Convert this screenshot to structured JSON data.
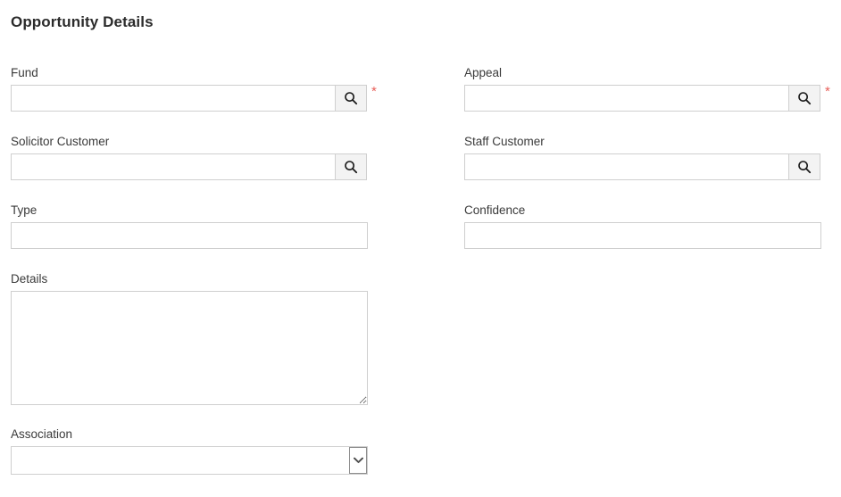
{
  "page": {
    "title": "Opportunity Details"
  },
  "colors": {
    "required_star": "#e8605a",
    "label_text": "#3a3a3a",
    "heading_text": "#2b2b2b",
    "input_border": "#cfcfcf",
    "button_face": "#f3f3f3",
    "page_background": "#ffffff"
  },
  "required_marker": "*",
  "icons": {
    "search": "search-icon",
    "chevron_down": "chevron-down-icon",
    "resize_grip": "resize-grip-icon"
  },
  "fields": {
    "fund": {
      "label": "Fund",
      "value": "",
      "placeholder": "",
      "type": "lookup",
      "required": true,
      "button_title": "Search"
    },
    "appeal": {
      "label": "Appeal",
      "value": "",
      "placeholder": "",
      "type": "lookup",
      "required": true,
      "button_title": "Search"
    },
    "solicitor_customer": {
      "label": "Solicitor Customer",
      "value": "",
      "placeholder": "",
      "type": "lookup",
      "required": false,
      "button_title": "Search"
    },
    "staff_customer": {
      "label": "Staff Customer",
      "value": "",
      "placeholder": "",
      "type": "lookup",
      "required": false,
      "button_title": "Search"
    },
    "type": {
      "label": "Type",
      "value": "",
      "placeholder": "",
      "type": "text",
      "required": false
    },
    "confidence": {
      "label": "Confidence",
      "value": "",
      "placeholder": "",
      "type": "text",
      "required": false
    },
    "details": {
      "label": "Details",
      "value": "",
      "placeholder": "",
      "type": "textarea",
      "required": false
    },
    "association": {
      "label": "Association",
      "value": "",
      "type": "select",
      "required": false,
      "options": [
        ""
      ]
    }
  }
}
